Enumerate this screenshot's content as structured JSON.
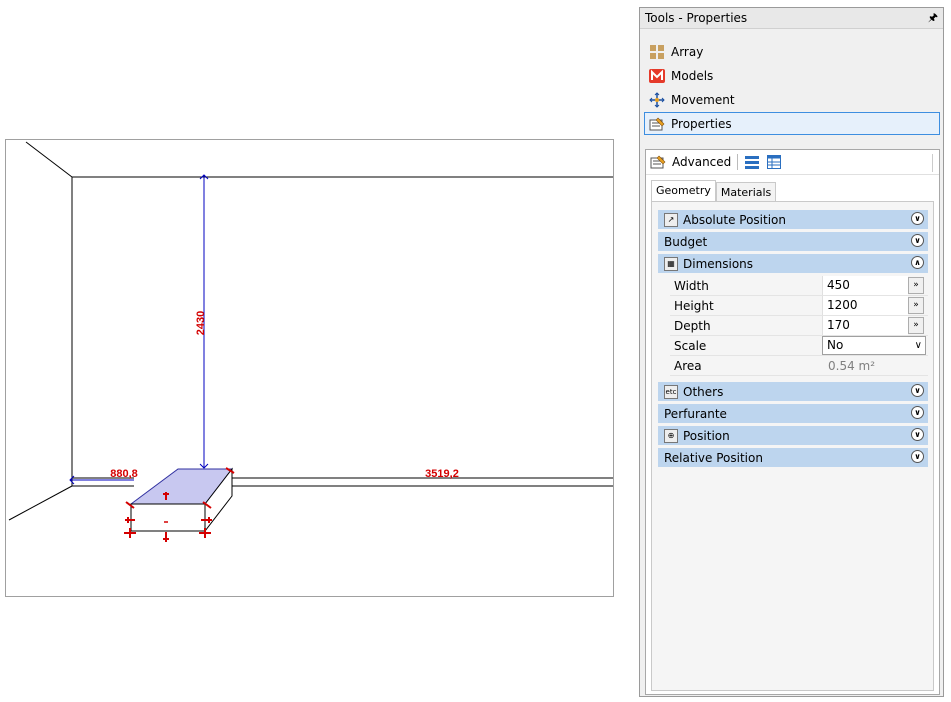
{
  "viewport": {
    "dimensions": {
      "height_label": "2430",
      "left_label": "880,8",
      "right_label": "3519,2"
    }
  },
  "panel": {
    "title": "Tools - Properties",
    "pin_icon": "pin-icon",
    "tools": [
      {
        "label": "Array",
        "icon": "array-icon",
        "selected": false
      },
      {
        "label": "Models",
        "icon": "models-icon",
        "selected": false
      },
      {
        "label": "Movement",
        "icon": "movement-icon",
        "selected": false
      },
      {
        "label": "Properties",
        "icon": "properties-icon",
        "selected": true
      }
    ],
    "toolbar": {
      "advanced_label": "Advanced"
    },
    "tabs": [
      {
        "label": "Geometry",
        "active": true
      },
      {
        "label": "Materials",
        "active": false
      }
    ],
    "sections": {
      "absolute_position": "Absolute Position",
      "budget": "Budget",
      "dimensions": "Dimensions",
      "others": "Others",
      "perfurante": "Perfurante",
      "position": "Position",
      "relative_position": "Relative Position"
    },
    "dimensions": {
      "width": {
        "label": "Width",
        "value": "450"
      },
      "height": {
        "label": "Height",
        "value": "1200"
      },
      "depth": {
        "label": "Depth",
        "value": "170"
      },
      "scale": {
        "label": "Scale",
        "value": "No"
      },
      "area": {
        "label": "Area",
        "value": "0.54 m²"
      }
    },
    "others_icon_text": "etc",
    "more_btn": "»"
  },
  "colors": {
    "accent": "#3d8ee0",
    "section_header": "#bdd5ee",
    "dimension_text": "#d40000",
    "dimension_line": "#0000c0",
    "selection_fill": "#c8c8f0"
  }
}
